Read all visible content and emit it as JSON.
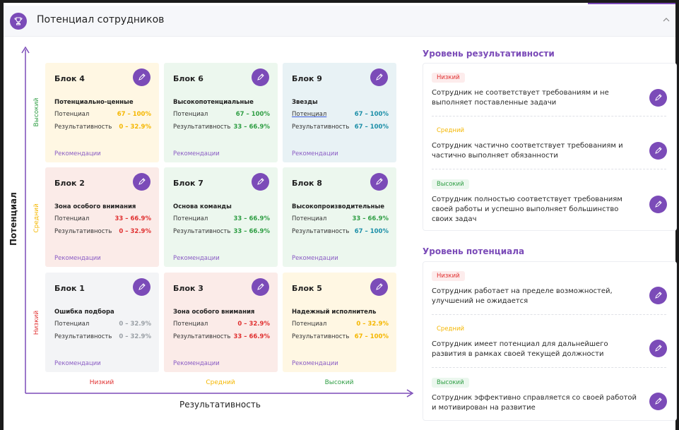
{
  "header": {
    "title": "Потенциал сотрудников",
    "icon": "trophy-icon",
    "collapse_icon": "chevron-up-icon"
  },
  "colors": {
    "accent": "#7b4bb8",
    "low": "#e03131",
    "mid": "#f5b700",
    "high": "#2f9e44",
    "teal": "#1c8fa8",
    "gray": "#9aa0a6"
  },
  "axes": {
    "y_title": "Потенциал",
    "x_title": "Результативность",
    "y_levels": [
      "Высокий",
      "Средний",
      "Низкий"
    ],
    "x_levels": [
      "Низкий",
      "Средний",
      "Высокий"
    ]
  },
  "blocks": [
    {
      "title": "Блок 4",
      "name": "Потенциально-ценные",
      "potential_label": "Потенциал",
      "potential_value": "67 – 100%",
      "result_label": "Результативность",
      "result_value": "0 – 32.9%",
      "rec": "Рекомендации"
    },
    {
      "title": "Блок 6",
      "name": "Высокопотенциальные",
      "potential_label": "Потенциал",
      "potential_value": "67 – 100%",
      "result_label": "Результативность",
      "result_value": "33 – 66.9%",
      "rec": "Рекомендации"
    },
    {
      "title": "Блок 9",
      "name": "Звезды",
      "potential_label": "Потенциал",
      "potential_value": "67 – 100%",
      "result_label": "Результативность",
      "result_value": "67 – 100%",
      "rec": "Рекомендации"
    },
    {
      "title": "Блок 2",
      "name": "Зона особого внимания",
      "potential_label": "Потенциал",
      "potential_value": "33 – 66.9%",
      "result_label": "Результативность",
      "result_value": "0 – 32.9%",
      "rec": "Рекомендации"
    },
    {
      "title": "Блок 7",
      "name": "Основа команды",
      "potential_label": "Потенциал",
      "potential_value": "33 – 66.9%",
      "result_label": "Результативность",
      "result_value": "33 – 66.9%",
      "rec": "Рекомендации"
    },
    {
      "title": "Блок 8",
      "name": "Высокопроизводительные",
      "potential_label": "Потенциал",
      "potential_value": "33 – 66.9%",
      "result_label": "Результативность",
      "result_value": "67 – 100%",
      "rec": "Рекомендации"
    },
    {
      "title": "Блок 1",
      "name": "Ошибка подбора",
      "potential_label": "Потенциал",
      "potential_value": "0 – 32.9%",
      "result_label": "Результативность",
      "result_value": "0 – 32.9%",
      "rec": "Рекомендации"
    },
    {
      "title": "Блок 3",
      "name": "Зона особого внимания",
      "potential_label": "Потенциал",
      "potential_value": "0 – 32.9%",
      "result_label": "Результативность",
      "result_value": "33 – 66.9%",
      "rec": "Рекомендации"
    },
    {
      "title": "Блок 5",
      "name": "Надежный исполнитель",
      "potential_label": "Потенциал",
      "potential_value": "0 – 32.9%",
      "result_label": "Результативность",
      "result_value": "67 – 100%",
      "rec": "Рекомендации"
    }
  ],
  "performance": {
    "title": "Уровень результативности",
    "items": [
      {
        "badge": "Низкий",
        "text": "Сотрудник не соответствует требованиям и не выполняет поставленные задачи"
      },
      {
        "badge": "Средний",
        "text": "Сотрудник частично соответствует требованиям и частично выполняет обязанности"
      },
      {
        "badge": "Высокий",
        "text": "Сотрудник полностью соответствует требованиям своей работы и успешно выполняет большинство своих задач"
      }
    ]
  },
  "potential": {
    "title": "Уровень потенциала",
    "items": [
      {
        "badge": "Низкий",
        "text": "Сотрудник работает на пределе возможностей, улучшений не ожидается"
      },
      {
        "badge": "Средний",
        "text": "Сотрудник имеет потенциал для дальнейшего развития в рамках своей текущей должности"
      },
      {
        "badge": "Высокий",
        "text": "Сотрудник  эффективно справляется со своей работой и мотивирован на развитие"
      }
    ]
  }
}
